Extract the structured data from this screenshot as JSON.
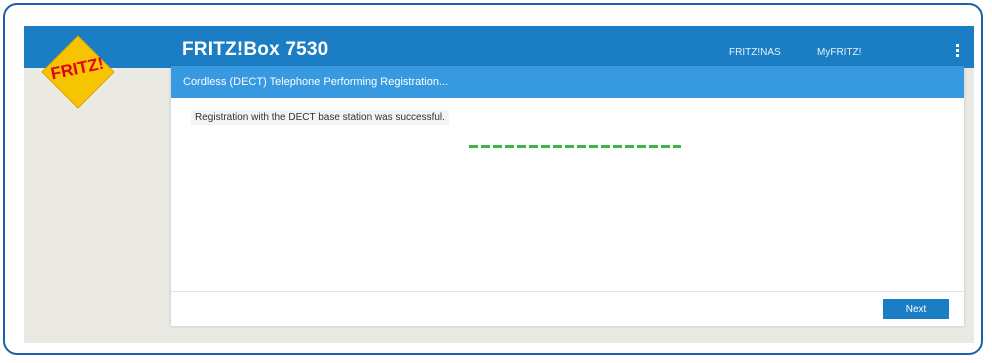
{
  "header": {
    "title": "FRITZ!Box 7530",
    "logo_text": "FRITZ!",
    "nav": [
      {
        "label": "FRITZ!NAS"
      },
      {
        "label": "MyFRITZ!"
      }
    ],
    "menu_icon": "kebab-menu-icon"
  },
  "panel": {
    "title": "Cordless (DECT) Telephone Performing Registration...",
    "message": "Registration with the DECT base station was successful.",
    "progress": 1.0
  },
  "footer": {
    "next_label": "Next"
  },
  "colors": {
    "header_blue": "#1b7dc4",
    "panel_header_blue": "#3799e0",
    "progress_green": "#3cb44a",
    "background": "#eae9e3",
    "logo_red": "#e2001a",
    "logo_yellow": "#f6c400"
  }
}
